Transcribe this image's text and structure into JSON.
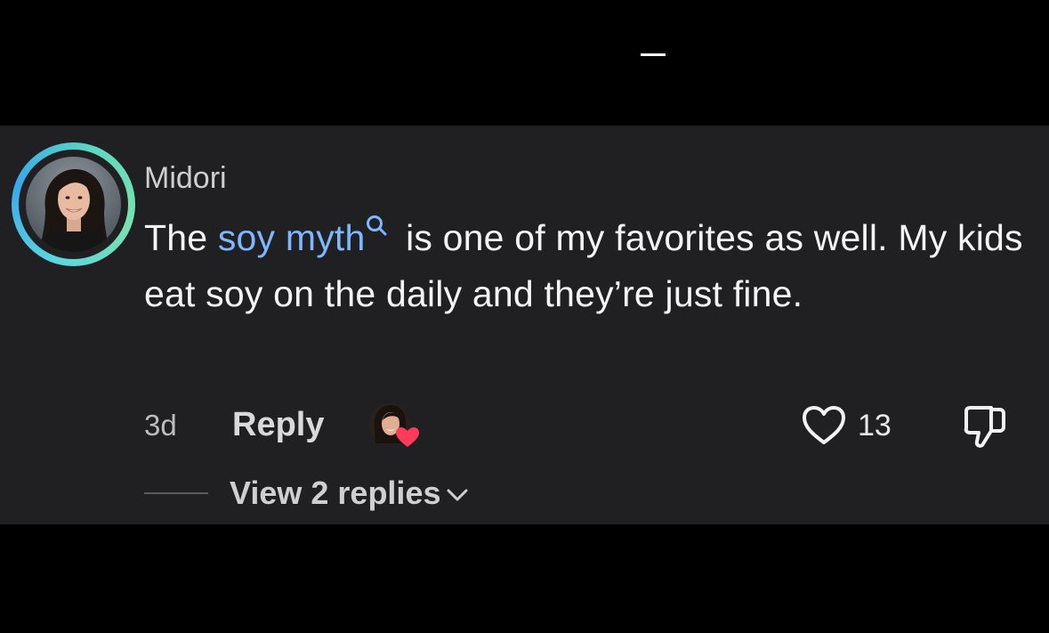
{
  "comment": {
    "username": "Midori",
    "text_before": "The ",
    "link_text": "soy myth",
    "text_after": " is one of my favorites as well. My kids eat soy on the daily and they’re just fine.",
    "time": "3d",
    "reply_label": "Reply",
    "like_count": "13",
    "view_replies_label": "View 2 replies",
    "creator_liked": true
  },
  "colors": {
    "background": "#000000",
    "card": "#202022",
    "link": "#7cb7ff",
    "heart": "#ff3b5c",
    "ring": "#5ad5e0"
  },
  "icons": {
    "search": "search-icon",
    "like": "heart-outline-icon",
    "dislike": "thumbs-down-icon",
    "creator_heart": "heart-filled-icon",
    "chevron": "chevron-down-icon"
  }
}
